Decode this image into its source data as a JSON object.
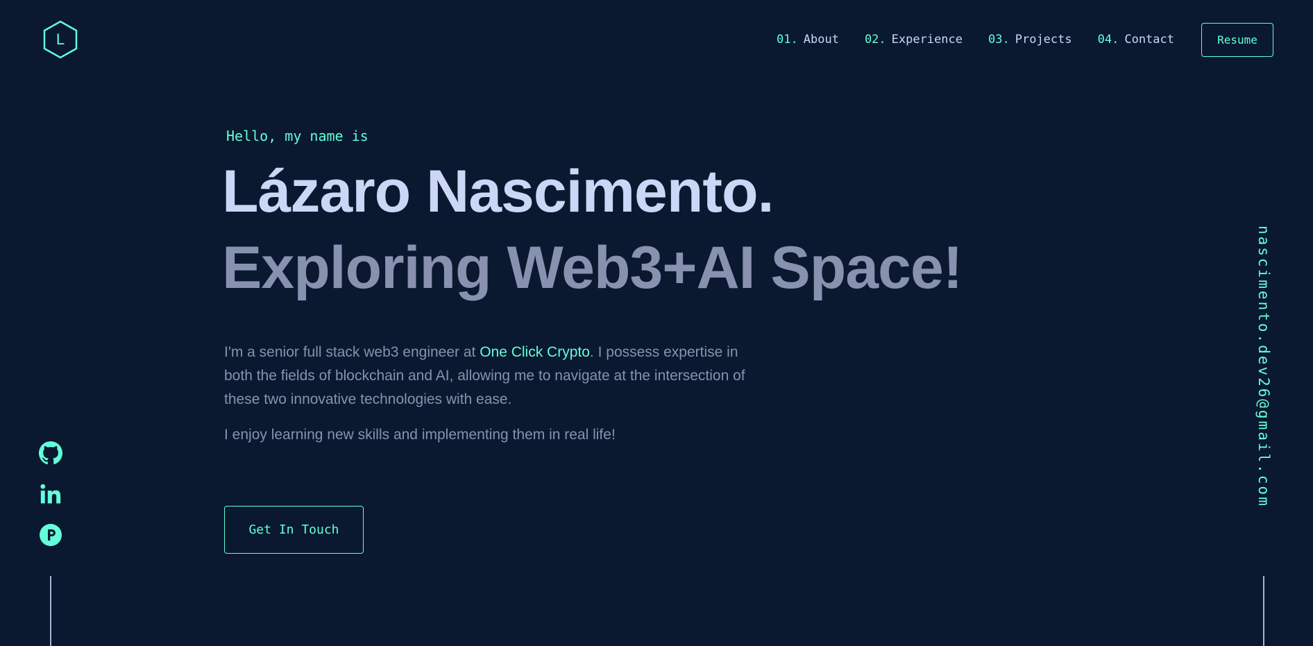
{
  "header": {
    "logo_letter": "L",
    "nav": [
      {
        "num": "01.",
        "label": "About"
      },
      {
        "num": "02.",
        "label": "Experience"
      },
      {
        "num": "03.",
        "label": "Projects"
      },
      {
        "num": "04.",
        "label": "Contact"
      }
    ],
    "resume_label": "Resume"
  },
  "hero": {
    "intro": "Hello, my name is",
    "name": "Lázaro Nascimento.",
    "tagline": "Exploring Web3+AI Space!",
    "bio_before": "I'm a senior full stack web3 engineer at ",
    "bio_link": "One Click Crypto",
    "bio_after": ". I possess expertise in both the fields of blockchain and AI, allowing me to navigate at the intersection of these two innovative technologies with ease.",
    "bio2": "I enjoy learning new skills and implementing them in real life!",
    "cta_label": "Get In Touch"
  },
  "social": [
    {
      "icon": "github-icon"
    },
    {
      "icon": "linkedin-icon"
    },
    {
      "icon": "producthunt-icon"
    }
  ],
  "email": "nascimento.dev26@gmail.com",
  "colors": {
    "background": "#0a192f",
    "accent": "#64ffda",
    "heading": "#ccd6f6",
    "muted": "#8892b0"
  }
}
